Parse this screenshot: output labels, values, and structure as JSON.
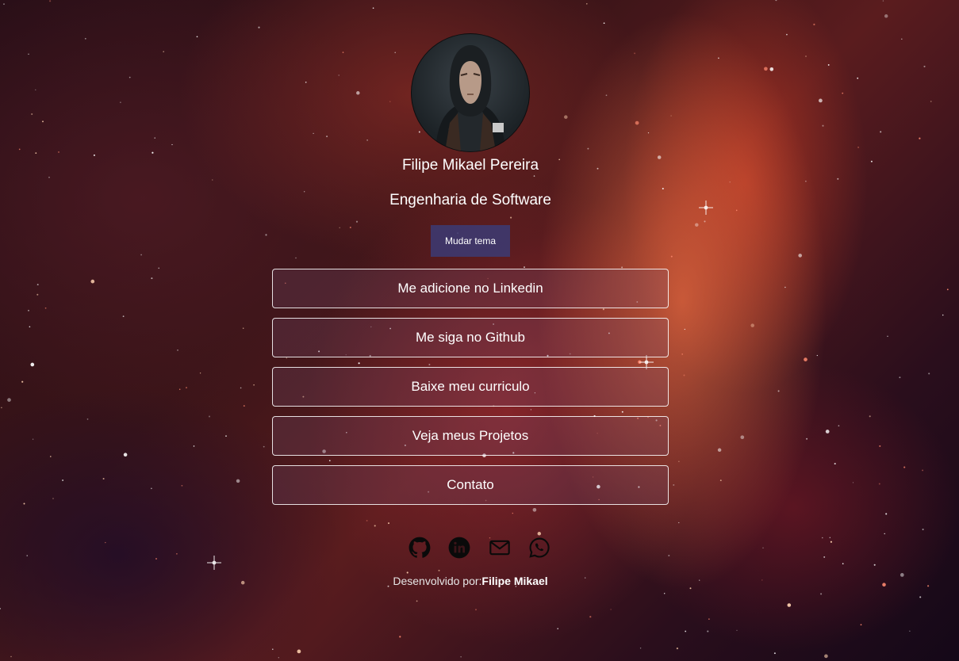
{
  "profile": {
    "name": "Filipe Mikael Pereira",
    "role": "Engenharia de Software",
    "avatar_icon": "hooded-person-portrait"
  },
  "theme_button": {
    "label": "Mudar tema",
    "color": "#3a3c78"
  },
  "links": [
    {
      "label": "Me adicione no Linkedin"
    },
    {
      "label": "Me siga no Github"
    },
    {
      "label": "Baixe meu curriculo"
    },
    {
      "label": "Veja meus Projetos"
    },
    {
      "label": "Contato"
    }
  ],
  "socials": [
    {
      "icon": "github-icon"
    },
    {
      "icon": "linkedin-icon"
    },
    {
      "icon": "mail-icon"
    },
    {
      "icon": "whatsapp-icon"
    }
  ],
  "footer": {
    "prefix": "Desenvolvido por:",
    "author": "Filipe Mikael"
  },
  "colors": {
    "text": "#ffffff",
    "link_border": "#ffffff",
    "background_accent": "#c8402c"
  }
}
